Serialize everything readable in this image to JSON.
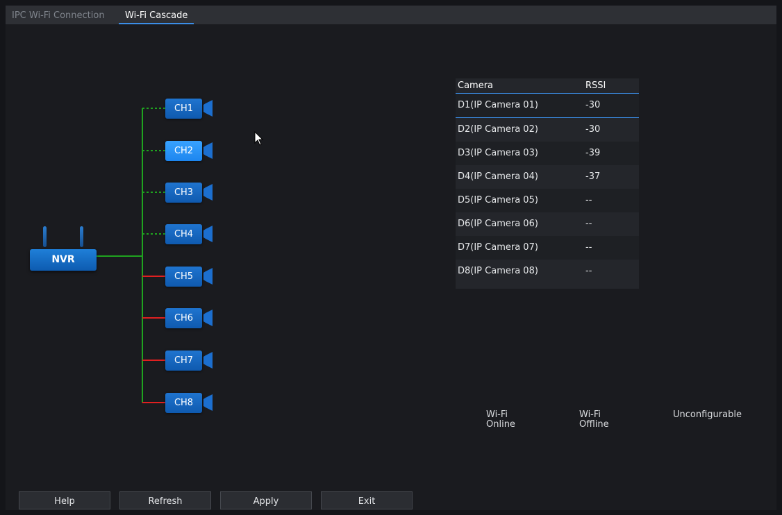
{
  "tabs": [
    {
      "label": "IPC Wi-Fi Connection",
      "active": false
    },
    {
      "label": "Wi-Fi Cascade",
      "active": true
    }
  ],
  "topology": {
    "nvr_label": "NVR",
    "channels": [
      {
        "label": "CH1",
        "status": "wifi-online"
      },
      {
        "label": "CH2",
        "status": "wifi-online",
        "highlighted": true
      },
      {
        "label": "CH3",
        "status": "wifi-online"
      },
      {
        "label": "CH4",
        "status": "wifi-online"
      },
      {
        "label": "CH5",
        "status": "unconfigurable"
      },
      {
        "label": "CH6",
        "status": "unconfigurable"
      },
      {
        "label": "CH7",
        "status": "unconfigurable"
      },
      {
        "label": "CH8",
        "status": "unconfigurable"
      }
    ]
  },
  "table": {
    "headers": [
      "Camera",
      "RSSI"
    ],
    "rows": [
      {
        "camera": "D1(IP Camera 01)",
        "rssi": "-30"
      },
      {
        "camera": "D2(IP Camera 02)",
        "rssi": "-30"
      },
      {
        "camera": "D3(IP Camera 03)",
        "rssi": "-39"
      },
      {
        "camera": "D4(IP Camera 04)",
        "rssi": "-37"
      },
      {
        "camera": "D5(IP Camera 05)",
        "rssi": "--"
      },
      {
        "camera": "D6(IP Camera 06)",
        "rssi": "--"
      },
      {
        "camera": "D7(IP Camera 07)",
        "rssi": "--"
      },
      {
        "camera": "D8(IP Camera 08)",
        "rssi": "--"
      }
    ]
  },
  "legend": {
    "wifi_online": [
      "Wi-Fi",
      "Online"
    ],
    "wifi_offline": [
      "Wi-Fi",
      "Offline"
    ],
    "unconfigurable": "Unconfigurable"
  },
  "colors": {
    "online": "#1fa31f",
    "offline": "#e02020",
    "accent": "#3b8ee8"
  },
  "buttons": {
    "help": "Help",
    "refresh": "Refresh",
    "apply": "Apply",
    "exit": "Exit"
  }
}
